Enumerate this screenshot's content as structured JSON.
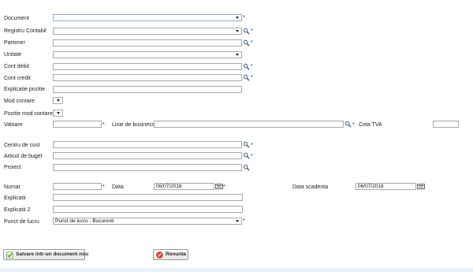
{
  "form": {
    "document": {
      "label": "Document",
      "value": ""
    },
    "registru_contabil": {
      "label": "Registru Contabil",
      "value": ""
    },
    "partener": {
      "label": "Partener",
      "value": ""
    },
    "unitate": {
      "label": "Unitate",
      "value": ""
    },
    "cont_debit": {
      "label": "Cont debit",
      "value": ""
    },
    "cont_credit": {
      "label": "Cont credit",
      "value": ""
    },
    "explicatie_pozitie": {
      "label": "Explicatie pozitie",
      "value": ""
    },
    "mod_contare": {
      "label": "Mod contare",
      "value": ""
    },
    "pozitie_mod_contare": {
      "label": "Pozitie mod contare",
      "value": ""
    },
    "valoare": {
      "label": "Valoare",
      "value": ""
    },
    "linie_de_business": {
      "label": "Linie de business",
      "value": ""
    },
    "cota_tva": {
      "label": "Cota TVA",
      "value": ""
    },
    "centru_de_cost": {
      "label": "Centru de cost",
      "value": ""
    },
    "articol_de_buget": {
      "label": "Articol de buget",
      "value": ""
    },
    "proiect": {
      "label": "Proiect",
      "value": ""
    },
    "numar": {
      "label": "Numar",
      "value": ""
    },
    "data": {
      "label": "Data",
      "value": "06/07/2018"
    },
    "data_scadenta": {
      "label": "Data scadenta",
      "value": "06/07/2018"
    },
    "explicatii": {
      "label": "Explicatii",
      "value": ""
    },
    "explicatii_2": {
      "label": "Explicatii 2",
      "value": ""
    },
    "punct_de_lucru": {
      "label": "Punct de lucru",
      "value": "Punct de lucru - Bucuresti"
    },
    "required_marker": "*"
  },
  "buttons": {
    "save_label": "Salvare intr-un document nou",
    "cancel_label": "Renunta"
  },
  "icons": {
    "lookup": "magnifier-icon",
    "calendar": "calendar-icon",
    "dropdown": "chevron-down-icon",
    "save": "checkmark-icon",
    "cancel": "cancel-icon"
  },
  "colors": {
    "focused_border": "#8aa7d6",
    "field_border": "#a9a9a9",
    "save_icon": "#5a9a2a",
    "cancel_icon": "#d8452b",
    "bottom_strip": "#eaf1f6"
  }
}
